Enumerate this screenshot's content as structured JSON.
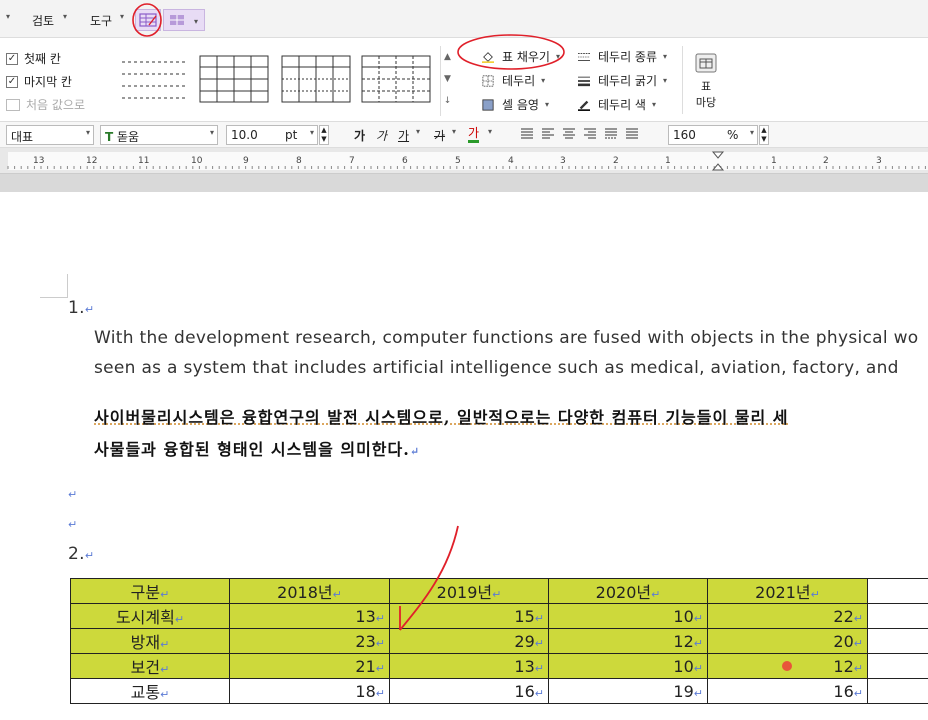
{
  "menu": {
    "review": "검토",
    "tools": "도구"
  },
  "options": {
    "first_col": "첫째 칸",
    "last_col": "마지막 칸",
    "reset": "처음 값으로"
  },
  "table_tools": {
    "fill": "표 채우기",
    "border": "테두리",
    "cell_shade": "셀 음영",
    "border_type": "테두리 종류",
    "border_weight": "테두리 굵기",
    "border_color": "테두리 색",
    "table_yard_top": "표",
    "table_yard_bottom": "마당"
  },
  "format": {
    "style": "대표",
    "font": "돋움",
    "size": "10.0",
    "unit": "pt",
    "bold": "가",
    "italic": "가",
    "underline": "가",
    "strike": "가",
    "color": "가",
    "zoom": "160",
    "pct": "%"
  },
  "ruler": [
    "13",
    "12",
    "11",
    "10",
    "9",
    "8",
    "7",
    "6",
    "5",
    "4",
    "3",
    "2",
    "1",
    "1",
    "2",
    "3"
  ],
  "doc": {
    "item1": "1.",
    "en1": "With the development research, computer functions are fused with objects in the physical wo",
    "en2": "seen as a system that includes artificial intelligence such as medical, aviation, factory, and",
    "ko1": "사이버물리시스템은 융합연구의 발전 시스템으로, 일반적으로는 다양한 컴퓨터 기능들이 물리 세",
    "ko2": "사물들과 융합된 형태인 시스템을 의미한다.",
    "item2": "2."
  },
  "table": {
    "headers": [
      "구분",
      "2018년",
      "2019년",
      "2020년",
      "2021년"
    ],
    "rows": [
      {
        "label": "도시계획",
        "values": [
          "13",
          "15",
          "10",
          "22"
        ]
      },
      {
        "label": "방재",
        "values": [
          "23",
          "29",
          "12",
          "20"
        ]
      },
      {
        "label": "보건",
        "values": [
          "21",
          "13",
          "10",
          "12"
        ]
      },
      {
        "label": "교통",
        "values": [
          "18",
          "16",
          "19",
          "16"
        ]
      }
    ]
  },
  "colors": {
    "highlight": "#cdd93b",
    "annotation": "#e0202a",
    "accent": "#8a5cc8"
  }
}
